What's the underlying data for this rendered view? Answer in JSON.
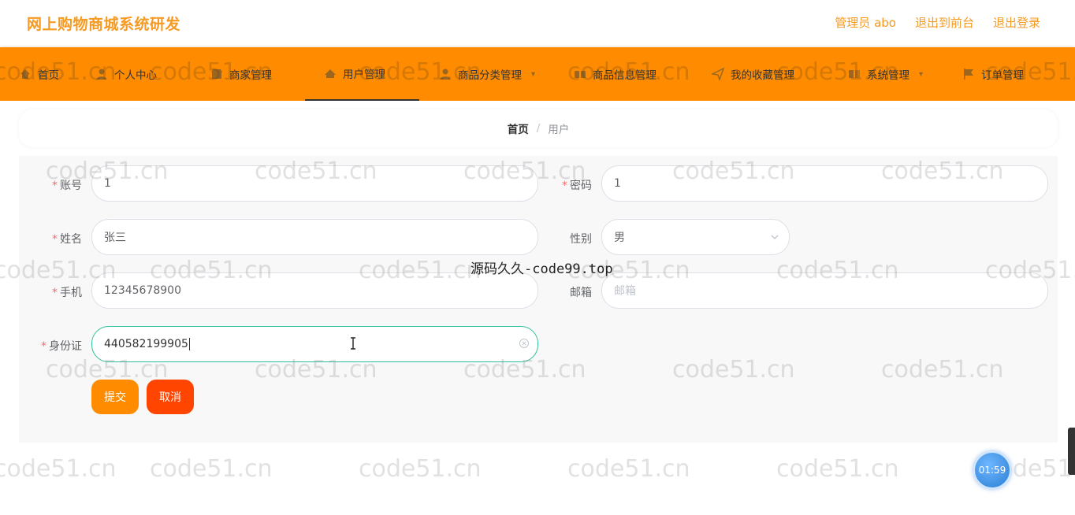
{
  "header": {
    "brand": "网上购物商城系统研发",
    "admin_label": "管理员 abo",
    "to_front_label": "退出到前台",
    "logout_label": "退出登录"
  },
  "nav": {
    "items": [
      {
        "label": "首页",
        "icon": "home-icon"
      },
      {
        "label": "个人中心",
        "icon": "user-icon"
      },
      {
        "label": "商家管理",
        "icon": "shop-icon"
      },
      {
        "label": "用户管理",
        "icon": "users-icon",
        "active": true
      },
      {
        "label": "商品分类管理",
        "icon": "category-icon"
      },
      {
        "label": "商品信息管理",
        "icon": "goods-icon"
      },
      {
        "label": "我的收藏管理",
        "icon": "send-icon"
      },
      {
        "label": "系统管理",
        "icon": "system-icon"
      },
      {
        "label": "订单管理",
        "icon": "flag-icon"
      }
    ]
  },
  "breadcrumb": {
    "home": "首页",
    "separator": "/",
    "current": "用户"
  },
  "form": {
    "account": {
      "label": "账号",
      "value": "1",
      "required": true
    },
    "password": {
      "label": "密码",
      "value": "1",
      "required": true
    },
    "name": {
      "label": "姓名",
      "value": "张三",
      "required": true
    },
    "gender": {
      "label": "性别",
      "value": "男",
      "required": false
    },
    "phone": {
      "label": "手机",
      "value": "12345678900",
      "required": true
    },
    "email": {
      "label": "邮箱",
      "placeholder": "邮箱",
      "value": "",
      "required": false
    },
    "id_card": {
      "label": "身份证",
      "value": "440582199905",
      "required": true
    },
    "submit_label": "提交",
    "cancel_label": "取消"
  },
  "watermark": {
    "text": "code51.cn",
    "center_text": "源码久久-code99.top"
  },
  "timer": {
    "value": "01:59"
  },
  "colors": {
    "brand": "#f59a23",
    "nav_bg": "#ff8c00",
    "submit": "#ff8c00",
    "cancel": "#ff4500",
    "focus": "#2fbf9b",
    "required": "#f56c6c"
  }
}
